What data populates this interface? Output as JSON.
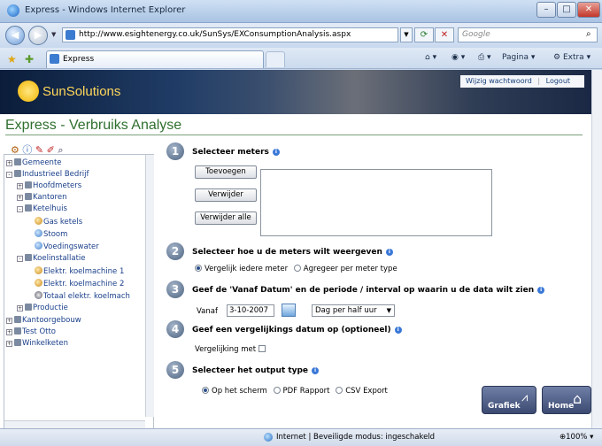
{
  "window": {
    "title": "Express - Windows Internet Explorer",
    "minimize": "–",
    "maximize": "□",
    "close": "✕"
  },
  "address_bar": {
    "url": "http://www.esightenergy.co.uk/SunSys/EXConsumptionAnalysis.aspx",
    "search_placeholder": "Google"
  },
  "tab": {
    "label": "Express"
  },
  "toolbar": {
    "pagina": "Pagina",
    "extra": "Extra"
  },
  "site": {
    "brand": "SunSolutions",
    "links": {
      "change_password": "Wijzig wachtwoord",
      "separator": "|",
      "logout": "Logout"
    },
    "page_title": "Express - Verbruiks Analyse"
  },
  "tree": [
    {
      "label": "Gemeente",
      "level": 0,
      "icon": "building",
      "expander": "+"
    },
    {
      "label": "Industrieel Bedrijf",
      "level": 0,
      "icon": "building",
      "expander": "-"
    },
    {
      "label": "Hoofdmeters",
      "level": 1,
      "icon": "folder",
      "expander": "+"
    },
    {
      "label": "Kantoren",
      "level": 1,
      "icon": "folder",
      "expander": "+"
    },
    {
      "label": "Ketelhuis",
      "level": 1,
      "icon": "folder",
      "expander": "-"
    },
    {
      "label": "Gas ketels",
      "level": 2,
      "icon": "gas-meter"
    },
    {
      "label": "Stoom",
      "level": 2,
      "icon": "meter"
    },
    {
      "label": "Voedingswater",
      "level": 2,
      "icon": "meter"
    },
    {
      "label": "Koelinstallatie",
      "level": 1,
      "icon": "folder",
      "expander": "-"
    },
    {
      "label": "Elektr. koelmachine 1",
      "level": 2,
      "icon": "electric-meter"
    },
    {
      "label": "Elektr. koelmachine 2",
      "level": 2,
      "icon": "electric-meter"
    },
    {
      "label": "Totaal elektr. koelmach",
      "level": 2,
      "icon": "sum-meter"
    },
    {
      "label": "Productie",
      "level": 1,
      "icon": "folder",
      "expander": "+"
    },
    {
      "label": "Kantoorgebouw",
      "level": 0,
      "icon": "building",
      "expander": "+"
    },
    {
      "label": "Test Otto",
      "level": 0,
      "icon": "building",
      "expander": "+"
    },
    {
      "label": "Winkelketen",
      "level": 0,
      "icon": "building",
      "expander": "+"
    }
  ],
  "steps": {
    "s1": {
      "num": "1",
      "title": "Selecteer meters",
      "add": "Toevoegen",
      "remove": "Verwijder",
      "remove_all": "Verwijder alle"
    },
    "s2": {
      "num": "2",
      "title": "Selecteer hoe u de meters wilt weergeven",
      "opt1": "Vergelijk iedere meter",
      "opt2": "Agregeer per meter type",
      "selected": "opt1"
    },
    "s3": {
      "num": "3",
      "title": "Geef de 'Vanaf Datum' en de periode / interval op waarin u de data wilt zien",
      "from_label": "Vanaf",
      "from_value": "3-10-2007",
      "interval": "Dag per half uur"
    },
    "s4": {
      "num": "4",
      "title": "Geef een vergelijkings datum op (optioneel)",
      "compare_label": "Vergelijking met",
      "checked": false
    },
    "s5": {
      "num": "5",
      "title": "Selecteer het output type",
      "opt1": "Op het scherm",
      "opt2": "PDF Rapport",
      "opt3": "CSV Export",
      "selected": "opt1"
    }
  },
  "buttons": {
    "graph": "Grafiek",
    "home": "Home"
  },
  "statusbar": {
    "zone": "Internet | Beveiligde modus: ingeschakeld",
    "zoom": "100%"
  }
}
